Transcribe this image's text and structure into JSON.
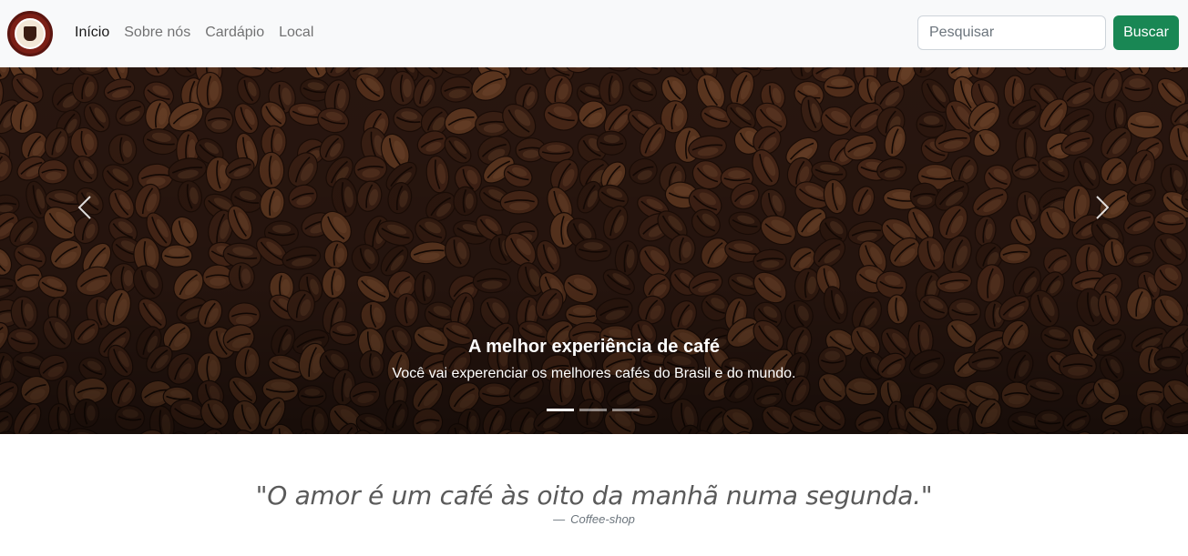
{
  "navbar": {
    "brand_logo_text": "Coffee-shop",
    "links": [
      {
        "label": "Início",
        "active": true
      },
      {
        "label": "Sobre nós",
        "active": false
      },
      {
        "label": "Cardápio",
        "active": false
      },
      {
        "label": "Local",
        "active": false
      }
    ],
    "search": {
      "placeholder": "Pesquisar",
      "value": ""
    },
    "search_button": "Buscar"
  },
  "carousel": {
    "caption_title": "A melhor experiência de café",
    "caption_text": "Você vai experenciar os melhores cafés do Brasil e do mundo.",
    "slides_count": 3,
    "active_slide": 1,
    "prev_icon": "chevron-left-icon",
    "next_icon": "chevron-right-icon"
  },
  "quote": {
    "text": "\"O amor é um café às oito da manhã numa segunda.\"",
    "dash": "—",
    "author": "Coffee-shop"
  },
  "colors": {
    "navbar_bg": "#f8f9fa",
    "search_button_bg": "#198754",
    "carousel_bg": "#2a1710"
  }
}
